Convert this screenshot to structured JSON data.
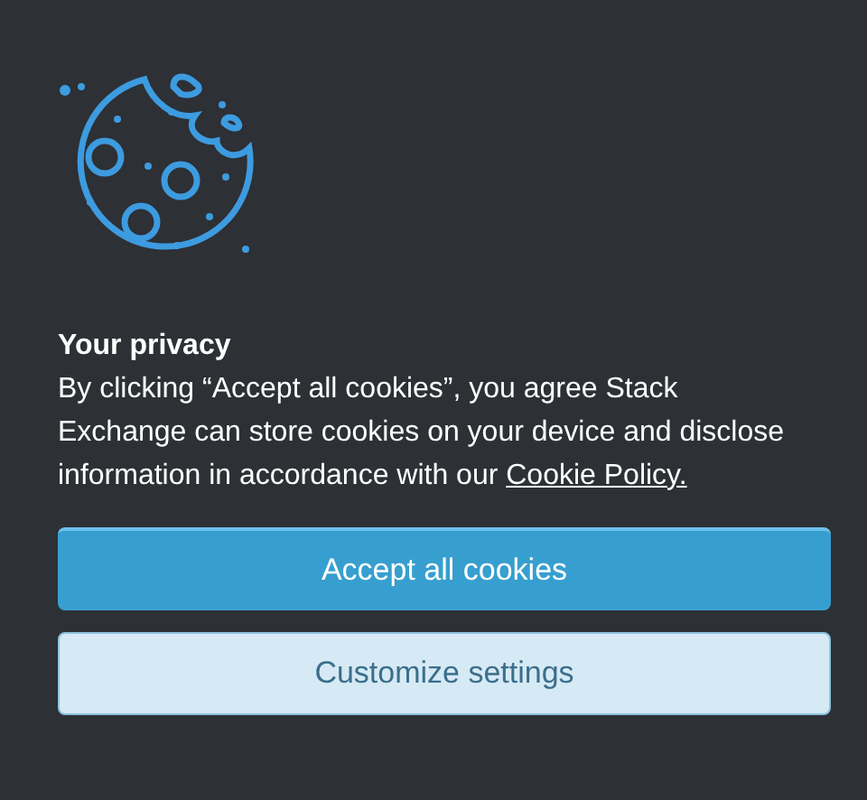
{
  "title": "Your privacy",
  "message": {
    "text": "By clicking “Accept all cookies”, you agree Stack Exchange can store cookies on your device and disclose information in accordance with our ",
    "link": "Cookie Policy."
  },
  "buttons": [
    {
      "label": "Accept all cookies",
      "kind": "primary"
    },
    {
      "label": "Customize settings",
      "kind": "secondary"
    }
  ]
}
